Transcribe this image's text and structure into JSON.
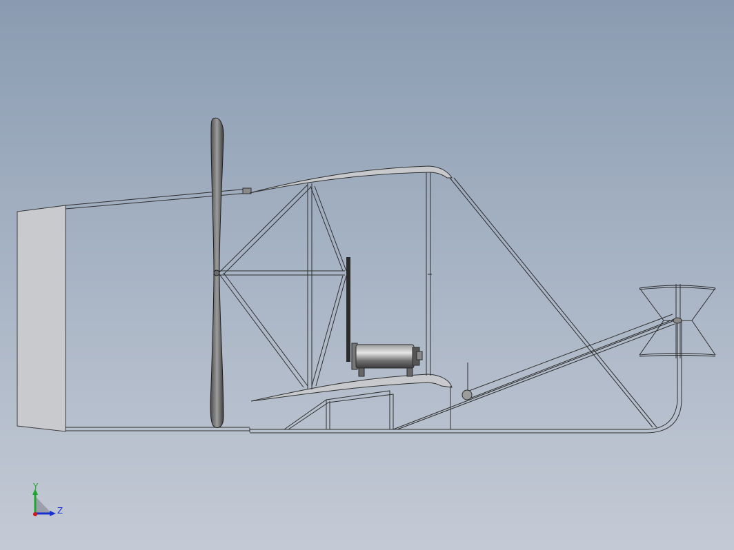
{
  "viewport": {
    "background_top": "#8a9bb1",
    "background_bottom": "#c4cad5",
    "model_edge_color": "#2a2a2a",
    "model_fill_color": "#c9cbcf"
  },
  "triad": {
    "y_label": "Y",
    "z_label": "Z",
    "y_color": "#1fa82e",
    "z_color": "#1a2fd0",
    "origin_color": "#d01818"
  }
}
